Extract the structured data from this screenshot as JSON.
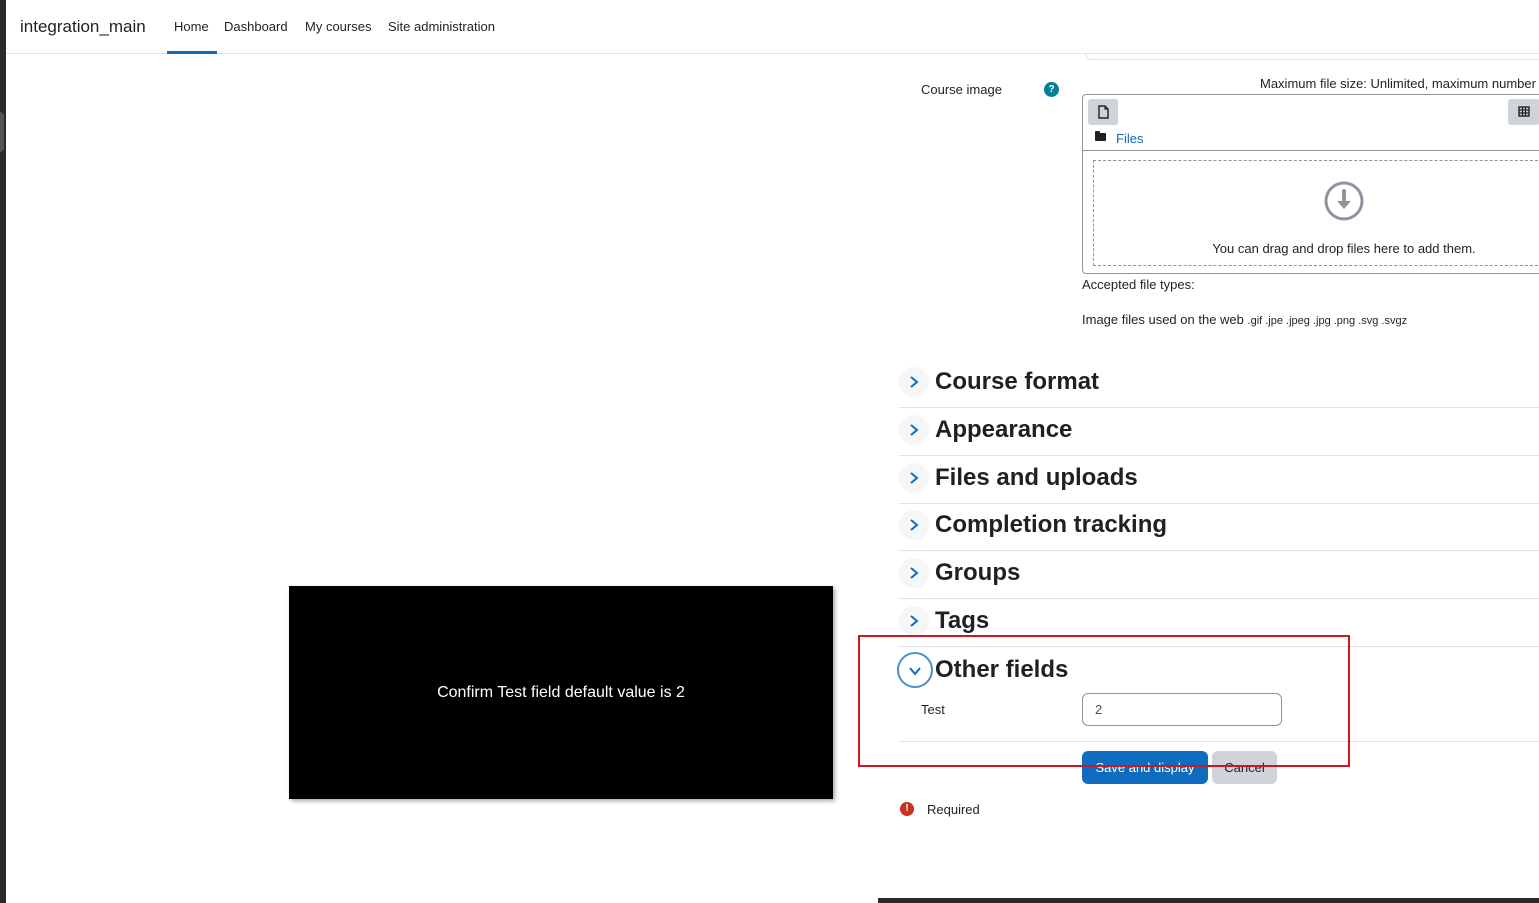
{
  "navbar": {
    "brand": "integration_main",
    "items": [
      "Home",
      "Dashboard",
      "My courses",
      "Site administration"
    ]
  },
  "course_image": {
    "label": "Course image",
    "help_glyph": "?",
    "max_size_text": "Maximum file size: Unlimited, maximum number",
    "files_link": "Files",
    "drop_text": "You can drag and drop files here to add them.",
    "accepted_label": "Accepted file types:",
    "accepted_desc": "Image files used on the web",
    "accepted_exts": ".gif .jpe .jpeg .jpg .png .svg .svgz"
  },
  "sections": [
    "Course format",
    "Appearance",
    "Files and uploads",
    "Completion tracking",
    "Groups",
    "Tags"
  ],
  "other_fields": {
    "title": "Other fields",
    "test_label": "Test",
    "test_value": "2"
  },
  "buttons": {
    "save": "Save and display",
    "cancel": "Cancel"
  },
  "required": {
    "glyph": "!",
    "text": "Required"
  },
  "overlay": {
    "text": "Confirm Test field default value is 2"
  },
  "colors": {
    "primary": "#0f6cbf",
    "help": "#008196",
    "required": "#ca3120",
    "highlight": "#d0161e"
  },
  "icons": {
    "file": "file-icon",
    "grid": "grid-view-icon",
    "folder": "folder-icon",
    "download": "download-arrow-icon",
    "chevron_right": "chevron-right-icon",
    "chevron_down": "chevron-down-icon"
  }
}
